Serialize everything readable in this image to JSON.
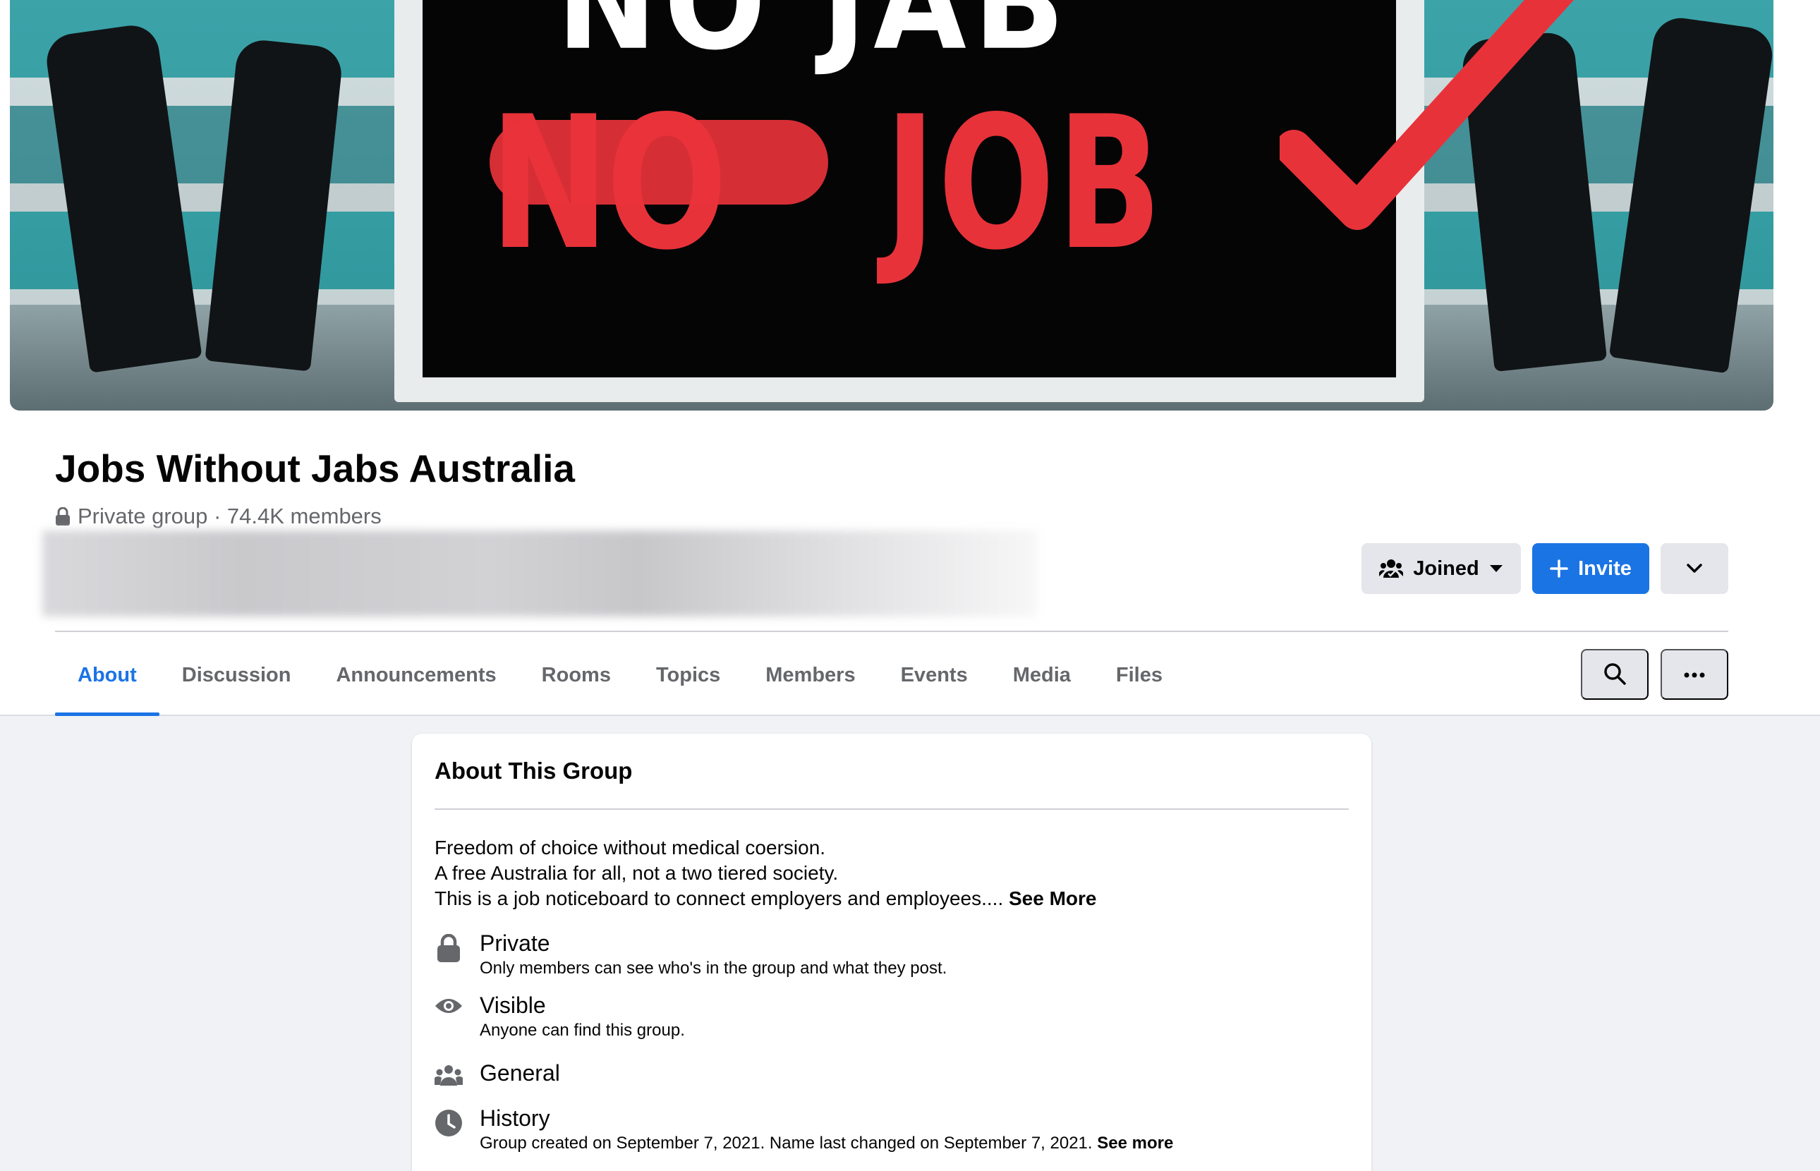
{
  "cover": {
    "line1": "NO JAB",
    "line2_struck": "NO",
    "line2_word": "JOB"
  },
  "group": {
    "name": "Jobs Without Jabs Australia",
    "meta": "Private group · 74.4K members"
  },
  "actions": {
    "joined_label": "Joined",
    "invite_label": "Invite"
  },
  "tabs": [
    {
      "label": "About",
      "active": true
    },
    {
      "label": "Discussion"
    },
    {
      "label": "Announcements"
    },
    {
      "label": "Rooms"
    },
    {
      "label": "Topics"
    },
    {
      "label": "Members"
    },
    {
      "label": "Events"
    },
    {
      "label": "Media"
    },
    {
      "label": "Files"
    }
  ],
  "about": {
    "title": "About This Group",
    "desc_line1": "Freedom of choice without medical coersion.",
    "desc_line2": "A free Australia for all, not a two tiered society.",
    "desc_line3": "This is a job noticeboard to connect employers and employees.... ",
    "see_more": "See More",
    "private_title": "Private",
    "private_desc": "Only members can see who's in the group and what they post.",
    "visible_title": "Visible",
    "visible_desc": "Anyone can find this group.",
    "general_title": "General",
    "history_title": "History",
    "history_desc": "Group created on September 7, 2021. Name last changed on September 7, 2021. ",
    "history_see_more": "See more"
  },
  "colors": {
    "accent": "#1b74e4",
    "cover_red": "#e8323a"
  },
  "icons": {
    "lock": "lock-icon",
    "joined": "group-joined-icon",
    "invite": "plus-icon",
    "search": "search-icon",
    "more": "more-horizontal-icon",
    "chevron": "chevron-down-icon",
    "eye": "eye-icon",
    "people": "people-icon",
    "clock": "clock-icon"
  }
}
